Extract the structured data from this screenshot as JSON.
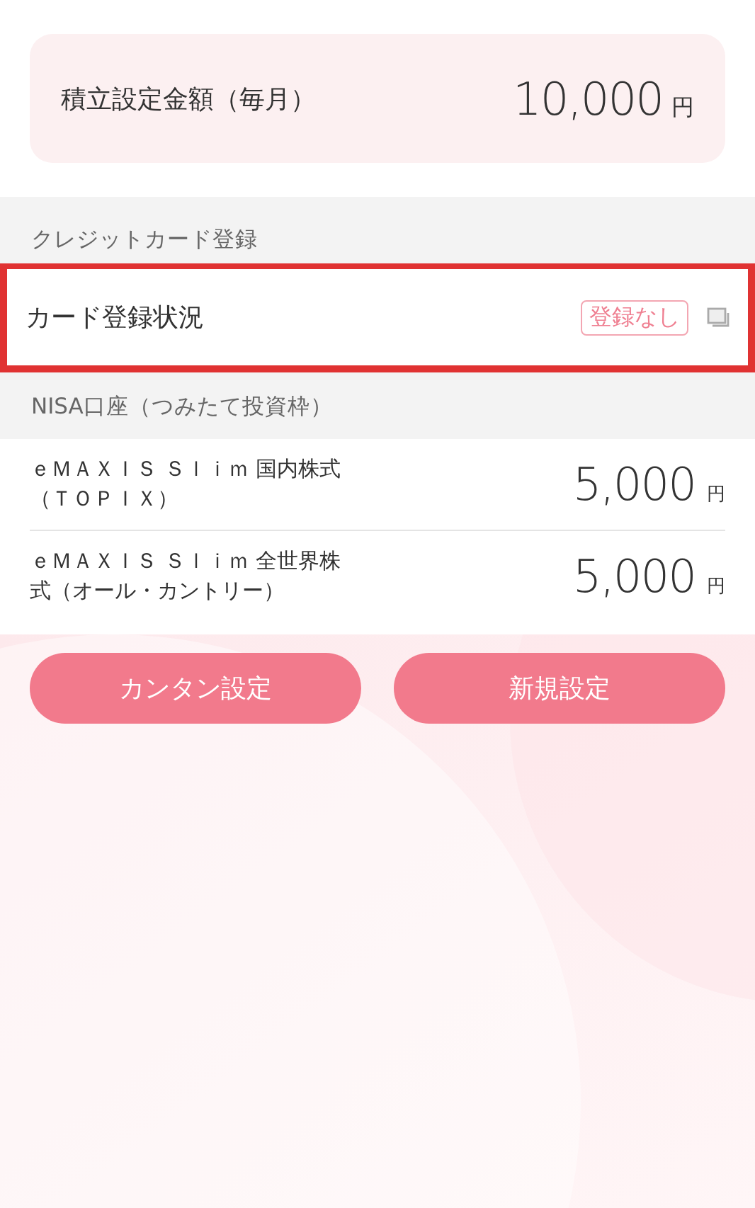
{
  "monthly_total": {
    "label": "積立設定金額（毎月）",
    "amount": "10,000",
    "unit": "円"
  },
  "credit_card": {
    "heading": "クレジットカード登録",
    "label": "カード登録状況",
    "status": "登録なし",
    "highlighted": true
  },
  "nisa": {
    "heading": "NISA口座（つみたて投資枠）",
    "funds": [
      {
        "name": "ｅＭＡＸＩＳ Ｓｌｉｍ 国内株式（ＴＯＰＩＸ）",
        "amount": "5,000",
        "unit": "円"
      },
      {
        "name": "ｅＭＡＸＩＳ Ｓｌｉｍ 全世界株式（オール・カントリー）",
        "amount": "5,000",
        "unit": "円"
      }
    ]
  },
  "buttons": [
    "カンタン設定",
    "新規設定"
  ]
}
